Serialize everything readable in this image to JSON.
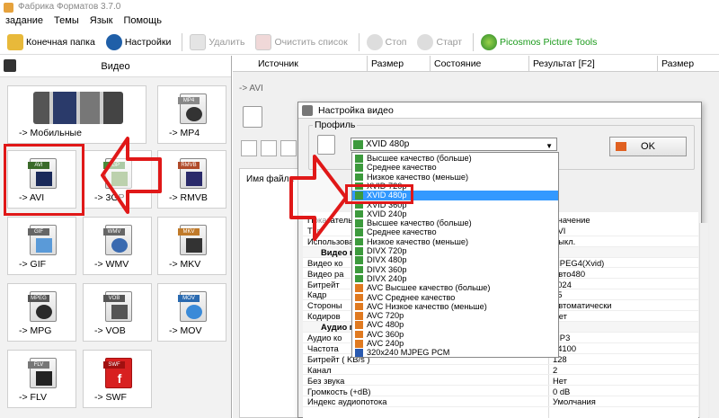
{
  "window": {
    "title": "Фабрика Форматов 3.7.0"
  },
  "menu": [
    "задание",
    "Темы",
    "Язык",
    "Помощь"
  ],
  "toolbar": {
    "output_folder": "Конечная папка",
    "settings": "Настройки",
    "delete": "Удалить",
    "clear_list": "Очистить список",
    "stop": "Стоп",
    "start": "Старт",
    "picosmos": "Picosmos Picture Tools"
  },
  "left_panel": {
    "title": "Видео",
    "tiles": [
      "-> Мобильные",
      "-> MP4",
      "-> AVI",
      "-> 3GP",
      "-> RMVB",
      "-> GIF",
      "-> WMV",
      "-> MKV",
      "-> MPG",
      "-> VOB",
      "-> MOV",
      "-> FLV",
      "-> SWF"
    ],
    "icon_tags": [
      "MP4",
      "AVI",
      "3GP",
      "RMVB",
      "GIF",
      "WMV",
      "MKV",
      "MPEG",
      "VOB",
      "MOV",
      "FLV",
      "SWF"
    ]
  },
  "columns": [
    "Источник",
    "Размер",
    "Состояние",
    "Результат [F2]",
    "Размер"
  ],
  "subwindow": {
    "title": "-> AVI",
    "file_name_col": "Имя файла"
  },
  "dialog": {
    "title": "Настройка видео",
    "profile_label": "Профиль",
    "selected": "XVID 480p",
    "ok": "OK",
    "options": [
      "Высшее качество (больше)",
      "Среднее качество",
      "Низкое качество (меньше)",
      "XVID 720p",
      "XVID 480p",
      "XVID 360p",
      "XVID 240p",
      "Высшее качество (больше)",
      "Среднее качество",
      "Низкое качество (меньше)",
      "DIVX 720p",
      "DIVX 480p",
      "DIVX 360p",
      "DIVX 240p",
      "AVC Высшее качество (больше)",
      "AVC Среднее качество",
      "AVC Низкое качество (меньше)",
      "AVC 720p",
      "AVC 480p",
      "AVC 360p",
      "AVC 240p",
      "320x240 MJPEG PCM"
    ],
    "selected_index": 4,
    "table_header": {
      "left": "Показатель",
      "right": "Значение"
    },
    "rows": [
      {
        "k": "Тип",
        "v": "AVI"
      },
      {
        "k": "Использовать",
        "v": "Выкл."
      },
      {
        "k": "Видео п",
        "v": "",
        "group": true
      },
      {
        "k": "Видео ко",
        "v": "MPEG4(Xvid)"
      },
      {
        "k": "Видео ра",
        "v": "Авто480"
      },
      {
        "k": "Битрейт",
        "v": "1024"
      },
      {
        "k": "Кадр",
        "v": "25"
      },
      {
        "k": "Стороны",
        "v": "Автоматически"
      },
      {
        "k": "Кодиров",
        "v": "Нет"
      },
      {
        "k": "Аудио п",
        "v": "",
        "group": true
      },
      {
        "k": "Аудио ко",
        "v": "MP3"
      },
      {
        "k": "Частота",
        "v": "44100"
      },
      {
        "k": "Битрейт ( KB/s )",
        "v": "128"
      },
      {
        "k": "Канал",
        "v": "2"
      },
      {
        "k": "Без звука",
        "v": "Нет"
      },
      {
        "k": "Громкость (+dB)",
        "v": "0 dB"
      },
      {
        "k": "Индекс аудиопотока",
        "v": "Умолчания"
      }
    ]
  },
  "colors": {
    "highlight": "#e01818",
    "selection": "#3399ff"
  }
}
